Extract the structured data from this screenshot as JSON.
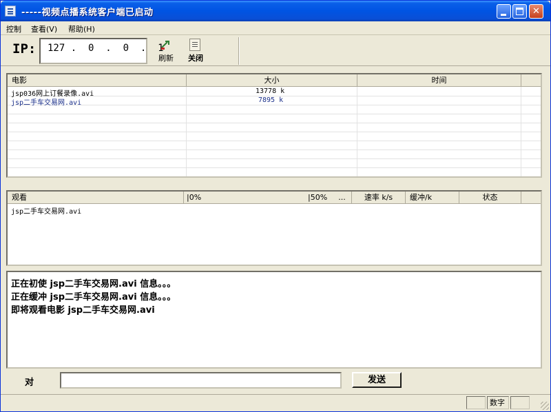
{
  "window": {
    "title": "-----视频点播系统客户端已启动"
  },
  "menu": [
    {
      "label": "控制"
    },
    {
      "label": "查看(V)"
    },
    {
      "label": "帮助(H)"
    }
  ],
  "toolbar": {
    "ip_label": "IP:",
    "ip_value": "127 .  0  .  0  .  1",
    "refresh_label": "刷新",
    "close_label": "关闭"
  },
  "movies": {
    "columns": [
      "电影",
      "大小",
      "时间"
    ],
    "rows": [
      {
        "name": "jsp036网上订餐录像.avi",
        "size": "13778 k",
        "time": ""
      },
      {
        "name": "jsp二手车交易网.avi",
        "size": "7895 k",
        "time": ""
      }
    ]
  },
  "watching": {
    "columns": [
      "观看",
      "|0%",
      "|50%",
      "...",
      "速率 k/s",
      "缓冲/k",
      "状态"
    ],
    "rows": [
      {
        "name": "jsp二手车交易网.avi"
      }
    ]
  },
  "messages": [
    "正在初使 jsp二手车交易网.avi 信息。。。",
    "正在缓冲 jsp二手车交易网.avi 信息。。。",
    "即将观看电影 jsp二手车交易网.avi"
  ],
  "chat": {
    "to_label": "对",
    "input_value": "",
    "send_label": "发送"
  },
  "status": {
    "num_label": "数字"
  }
}
